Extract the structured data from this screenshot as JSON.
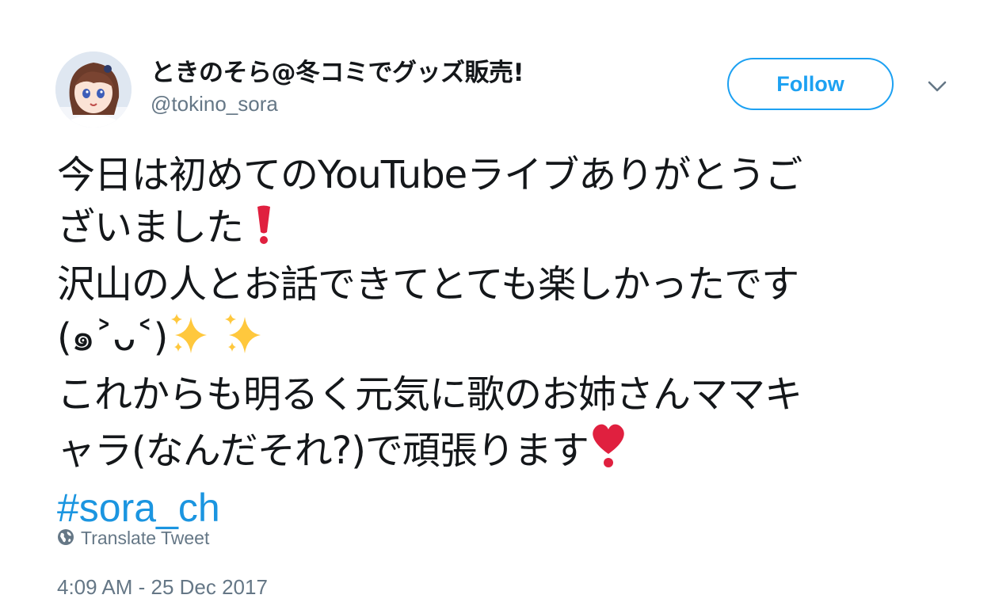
{
  "tweet": {
    "author": {
      "display_name": "ときのそら@冬コミでグッズ販売!",
      "handle": "@tokino_sora"
    },
    "follow_label": "Follow",
    "text_lines": [
      "今日は初めてのYouTubeライブありがとうご",
      "ざいました",
      "沢山の人とお話できてとても楽しかったです",
      "(๑˃ᴗ˂)",
      "これからも明るく元気に歌のお姉さんママキ",
      "ャラ(なんだそれ?)で頑張ります"
    ],
    "hashtag": "#sora_ch",
    "translate_label": "Translate Tweet",
    "timestamp": "4:09 AM - 25 Dec 2017"
  },
  "icons": {
    "more": "chevron-down-icon",
    "globe": "globe-icon",
    "exclamation": "red-exclamation-emoji",
    "sparkles": "sparkles-emoji",
    "heart": "red-heart-exclamation-emoji"
  },
  "colors": {
    "link": "#1da1f2",
    "hashtag": "#1b95e0",
    "secondary_text": "#657786",
    "primary_text": "#14171a"
  }
}
